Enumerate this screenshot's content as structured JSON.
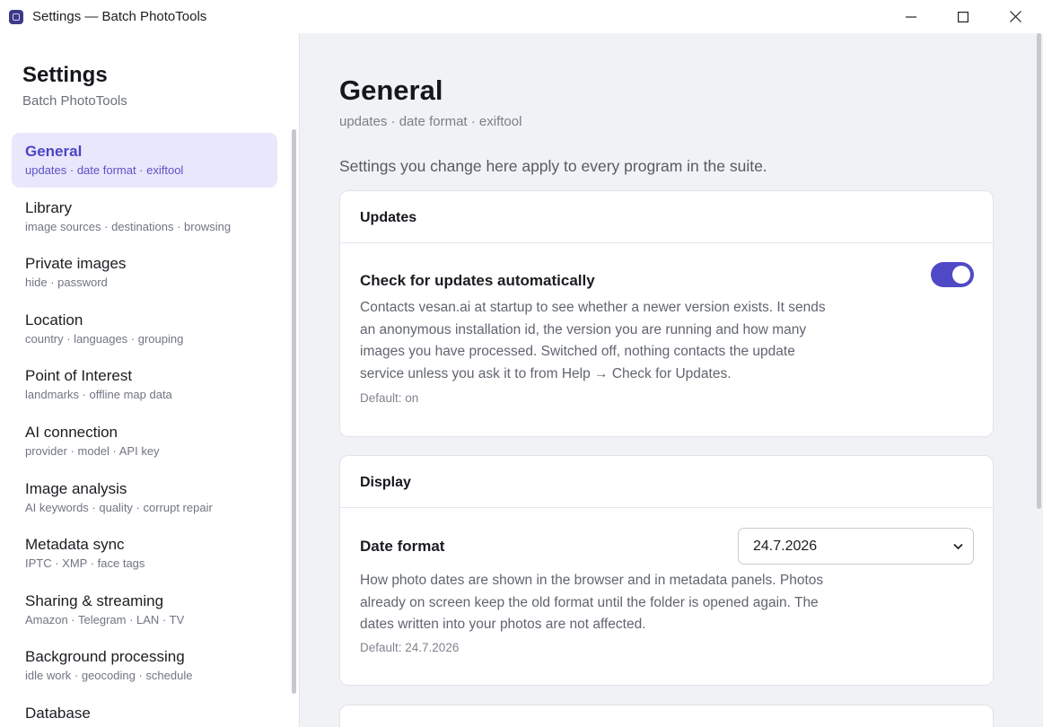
{
  "window": {
    "title": "Settings — Batch PhotoTools"
  },
  "sidebar": {
    "title": "Settings",
    "subtitle": "Batch PhotoTools",
    "items": [
      {
        "label": "General",
        "sub": "updates · date format · exiftool",
        "active": true
      },
      {
        "label": "Library",
        "sub": "image sources · destinations · browsing"
      },
      {
        "label": "Private images",
        "sub": "hide · password"
      },
      {
        "label": "Location",
        "sub": "country · languages · grouping"
      },
      {
        "label": "Point of Interest",
        "sub": "landmarks · offline map data"
      },
      {
        "label": "AI connection",
        "sub": "provider · model · API key"
      },
      {
        "label": "Image analysis",
        "sub": "AI keywords · quality · corrupt repair"
      },
      {
        "label": "Metadata sync",
        "sub": "IPTC · XMP · face tags"
      },
      {
        "label": "Sharing & streaming",
        "sub": "Amazon · Telegram · LAN · TV"
      },
      {
        "label": "Background processing",
        "sub": "idle work · geocoding · schedule"
      },
      {
        "label": "Database",
        "sub": ""
      }
    ]
  },
  "main": {
    "title": "General",
    "tags": "updates · date format · exiftool",
    "intro": "Settings you change here apply to every program in the suite.",
    "sections": {
      "updates": {
        "heading": "Updates",
        "setting_label": "Check for updates automatically",
        "description": "Contacts vesan.ai at startup to see whether a newer version exists. It sends an anonymous installation id, the version you are running and how many images you have processed. Switched off, nothing contacts the update service unless you ask it to from Help → Check for Updates.",
        "default": "Default: on",
        "enabled": true
      },
      "display": {
        "heading": "Display",
        "setting_label": "Date format",
        "selected": "24.7.2026",
        "description": "How photo dates are shown in the browser and in metadata panels. Photos already on screen keep the old format until the folder is opened again. The dates written into your photos are not affected.",
        "default": "Default: 24.7.2026"
      }
    }
  },
  "colors": {
    "accent": "#5049c6",
    "active_nav_bg": "#e9e7fb",
    "page_bg": "#f1f2f6"
  }
}
